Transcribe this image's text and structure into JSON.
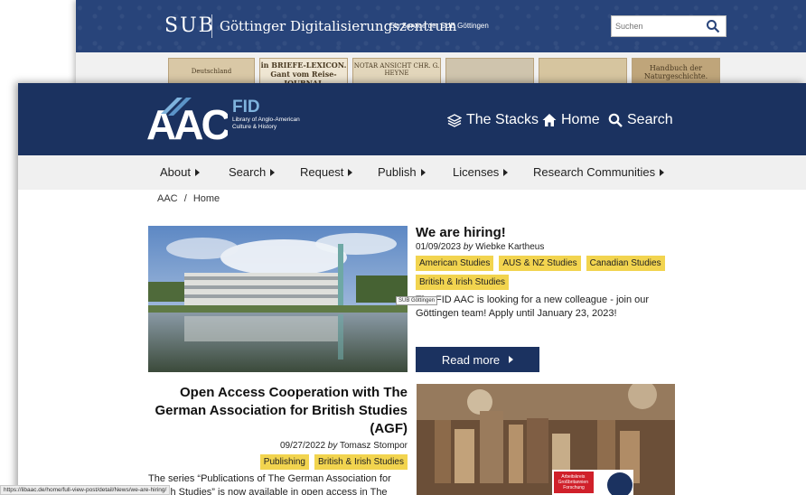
{
  "bg_window": {
    "logo": "SUB",
    "title": "Göttinger Digitalisierungszentrum",
    "subtitle": "Ein Service der SUB Göttingen",
    "search_placeholder": "Suchen",
    "books": [
      "Deutschland",
      "in BRIEFE-LEXICON. Gant vom Reise-JOURNAL",
      "NOTAR ANSICHT CHR. G. HEYNE",
      "",
      "",
      "Handbuch der Naturgeschichte."
    ]
  },
  "header": {
    "logo_text": "AAC",
    "fid_label": "FID",
    "fid_tagline": "Library of Anglo-American Culture & History",
    "links": [
      {
        "label": "The Stacks",
        "icon": "stack-icon"
      },
      {
        "label": "Home",
        "icon": "home-icon"
      },
      {
        "label": "Search",
        "icon": "search-icon"
      }
    ]
  },
  "nav": [
    "About",
    "Search",
    "Request",
    "Publish",
    "Licenses",
    "Research Communities"
  ],
  "breadcrumb": {
    "home_root": "AAC",
    "separator": "/",
    "current": "Home"
  },
  "post1": {
    "title": "We are hiring!",
    "date": "01/09/2023",
    "by": "by",
    "author": "Wiebke Kartheus",
    "tags": [
      "American Studies",
      "AUS & NZ Studies",
      "Canadian Studies",
      "British & Irish Studies"
    ],
    "excerpt": "The FID AAC is looking for a new colleague - join our Göttingen team! Apply until January 23, 2023!",
    "read_more": "Read more",
    "tooltip": "SUB Göttingen"
  },
  "post2": {
    "title": "Open Access Cooperation with The German Association for British Studies (AGF)",
    "date": "09/27/2022",
    "by": "by",
    "author": "Tomasz Stompor",
    "tags": [
      "Publishing",
      "British & Irish Studies"
    ],
    "excerpt": "The series “Publications of The German Association for British Studies” is now available in open access in The"
  },
  "photo2_sign": "Arbeitskreis Großbritannien Forschung",
  "status_url": "https://libaac.de/home/full-view-post/detail/News/we-are-hiring/",
  "colors": {
    "navy": "#1b3260",
    "tag_yellow": "#f2d44f",
    "bg_header": "#28447a"
  }
}
